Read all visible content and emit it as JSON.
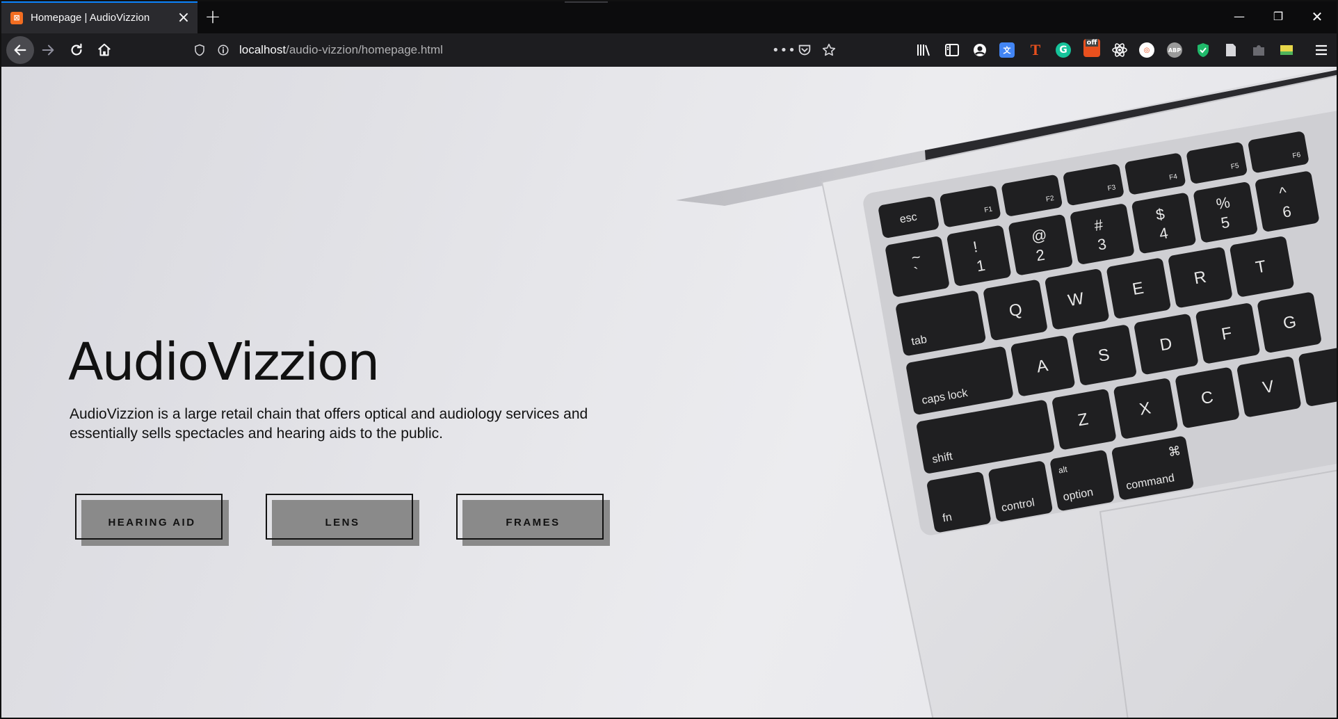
{
  "browser": {
    "tab": {
      "title": "Homepage | AudioVizzion",
      "favicon": "xampp-icon"
    },
    "new_tab_label": "+",
    "url": {
      "host": "localhost",
      "path": "/audio-vizzion/homepage.html"
    },
    "extensions": [
      {
        "name": "library-icon"
      },
      {
        "name": "sidebar-icon"
      },
      {
        "name": "account-icon"
      },
      {
        "name": "translate-icon"
      },
      {
        "name": "t-extension-icon",
        "text": "T"
      },
      {
        "name": "grammarly-icon",
        "text": "G"
      },
      {
        "name": "off-extension-icon",
        "text": "off"
      },
      {
        "name": "react-devtools-icon"
      },
      {
        "name": "extension-icon"
      },
      {
        "name": "adblock-plus-icon",
        "text": "ABP"
      },
      {
        "name": "shield-extension-icon"
      },
      {
        "name": "page-icon"
      },
      {
        "name": "puzzle-icon"
      },
      {
        "name": "note-icon"
      },
      {
        "name": "menu-icon"
      }
    ]
  },
  "hero": {
    "title": "AudioVizzion",
    "description": "AudioVizzion is a large retail chain that offers optical and audiology services and essentially sells spectacles and hearing aids to the public.",
    "buttons": [
      {
        "label": "HEARING AID"
      },
      {
        "label": "LENS"
      },
      {
        "label": "FRAMES"
      }
    ]
  },
  "keyboard": {
    "fn_row": [
      "esc",
      "F1",
      "F2",
      "F3",
      "F4",
      "F5",
      "F6"
    ],
    "number_row": [
      {
        "top": "~",
        "bottom": "`"
      },
      {
        "top": "!",
        "bottom": "1"
      },
      {
        "top": "@",
        "bottom": "2"
      },
      {
        "top": "#",
        "bottom": "3"
      },
      {
        "top": "$",
        "bottom": "4"
      },
      {
        "top": "%",
        "bottom": "5"
      },
      {
        "top": "^",
        "bottom": "6"
      }
    ],
    "qwerty_row": [
      "tab",
      "Q",
      "W",
      "E",
      "R",
      "T"
    ],
    "home_row": [
      "caps lock",
      "A",
      "S",
      "D",
      "F",
      "G"
    ],
    "bottom_row": [
      "shift",
      "Z",
      "X",
      "C",
      "V"
    ],
    "modifier_row": [
      "fn",
      "control",
      "alt",
      "option",
      "command"
    ]
  },
  "colors": {
    "tab_accent": "#0a84ff",
    "chrome_bg": "#0c0c0d",
    "toolbar_bg": "#1d1d20",
    "button_shadow": "#8a8a8a"
  }
}
